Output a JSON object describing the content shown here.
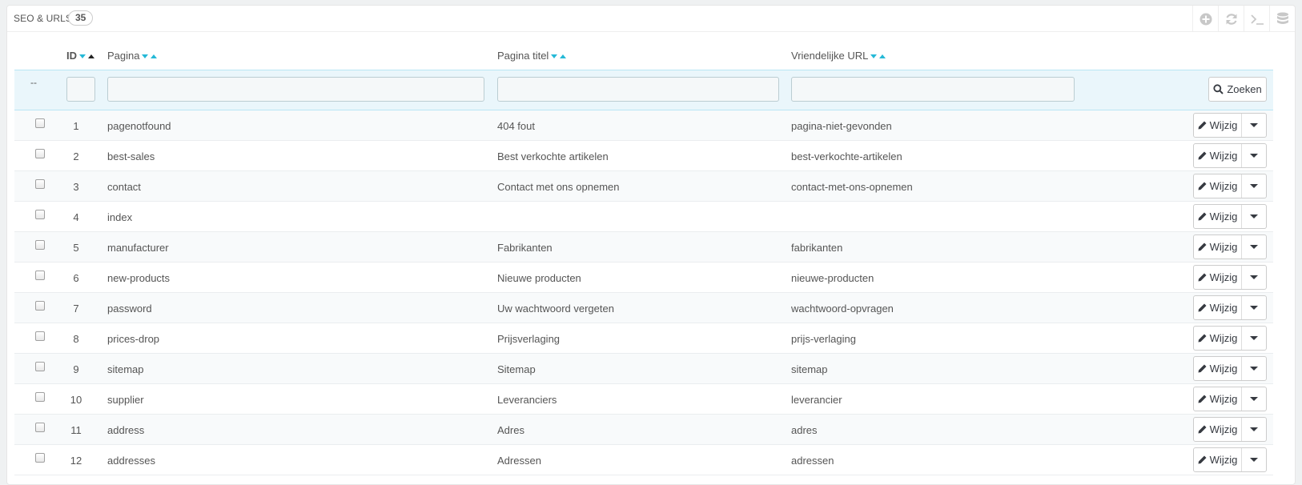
{
  "panel": {
    "title": "SEO & URLS",
    "count": "35"
  },
  "toolbar": {
    "icons": [
      "add-icon",
      "refresh-icon",
      "terminal-icon",
      "database-icon"
    ]
  },
  "columns": {
    "id": "ID",
    "page": "Pagina",
    "title": "Pagina titel",
    "url": "Vriendelijke URL"
  },
  "filter": {
    "dash": "--",
    "search_label": "Zoeken"
  },
  "row_action": {
    "edit_label": "Wijzig"
  },
  "rows": [
    {
      "id": "1",
      "page": "pagenotfound",
      "title": "404 fout",
      "url": "pagina-niet-gevonden"
    },
    {
      "id": "2",
      "page": "best-sales",
      "title": "Best verkochte artikelen",
      "url": "best-verkochte-artikelen"
    },
    {
      "id": "3",
      "page": "contact",
      "title": "Contact met ons opnemen",
      "url": "contact-met-ons-opnemen"
    },
    {
      "id": "4",
      "page": "index",
      "title": "",
      "url": ""
    },
    {
      "id": "5",
      "page": "manufacturer",
      "title": "Fabrikanten",
      "url": "fabrikanten"
    },
    {
      "id": "6",
      "page": "new-products",
      "title": "Nieuwe producten",
      "url": "nieuwe-producten"
    },
    {
      "id": "7",
      "page": "password",
      "title": "Uw wachtwoord vergeten",
      "url": "wachtwoord-opvragen"
    },
    {
      "id": "8",
      "page": "prices-drop",
      "title": "Prijsverlaging",
      "url": "prijs-verlaging"
    },
    {
      "id": "9",
      "page": "sitemap",
      "title": "Sitemap",
      "url": "sitemap"
    },
    {
      "id": "10",
      "page": "supplier",
      "title": "Leveranciers",
      "url": "leverancier"
    },
    {
      "id": "11",
      "page": "address",
      "title": "Adres",
      "url": "adres"
    },
    {
      "id": "12",
      "page": "addresses",
      "title": "Adressen",
      "url": "adressen"
    }
  ],
  "colors": {
    "accent": "#25b9d7",
    "filter_bg": "#eaf6fb"
  }
}
